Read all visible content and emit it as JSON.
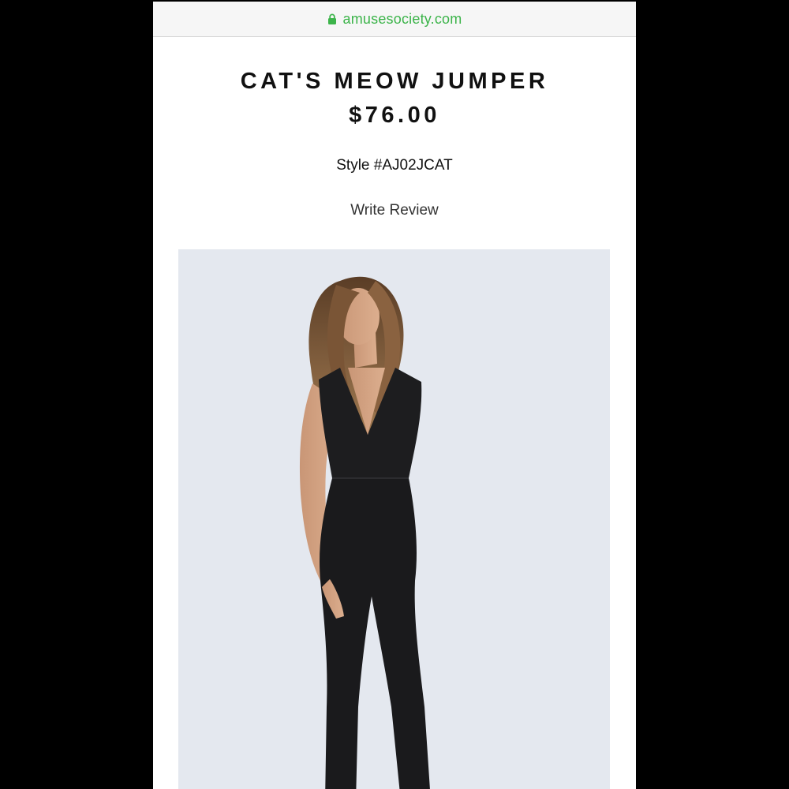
{
  "browser": {
    "url": "amusesociety.com",
    "icons": {
      "lock": "lock-icon"
    },
    "colors": {
      "url_text": "#3cb44a",
      "background": "#000000"
    }
  },
  "product": {
    "title": "CAT'S MEOW JUMPER",
    "price": "$76.00",
    "style_number": "Style #AJ02JCAT",
    "write_review_label": "Write Review",
    "image": {
      "subject": "model wearing black jumpsuit",
      "background_color": "#e4e8ef"
    }
  }
}
